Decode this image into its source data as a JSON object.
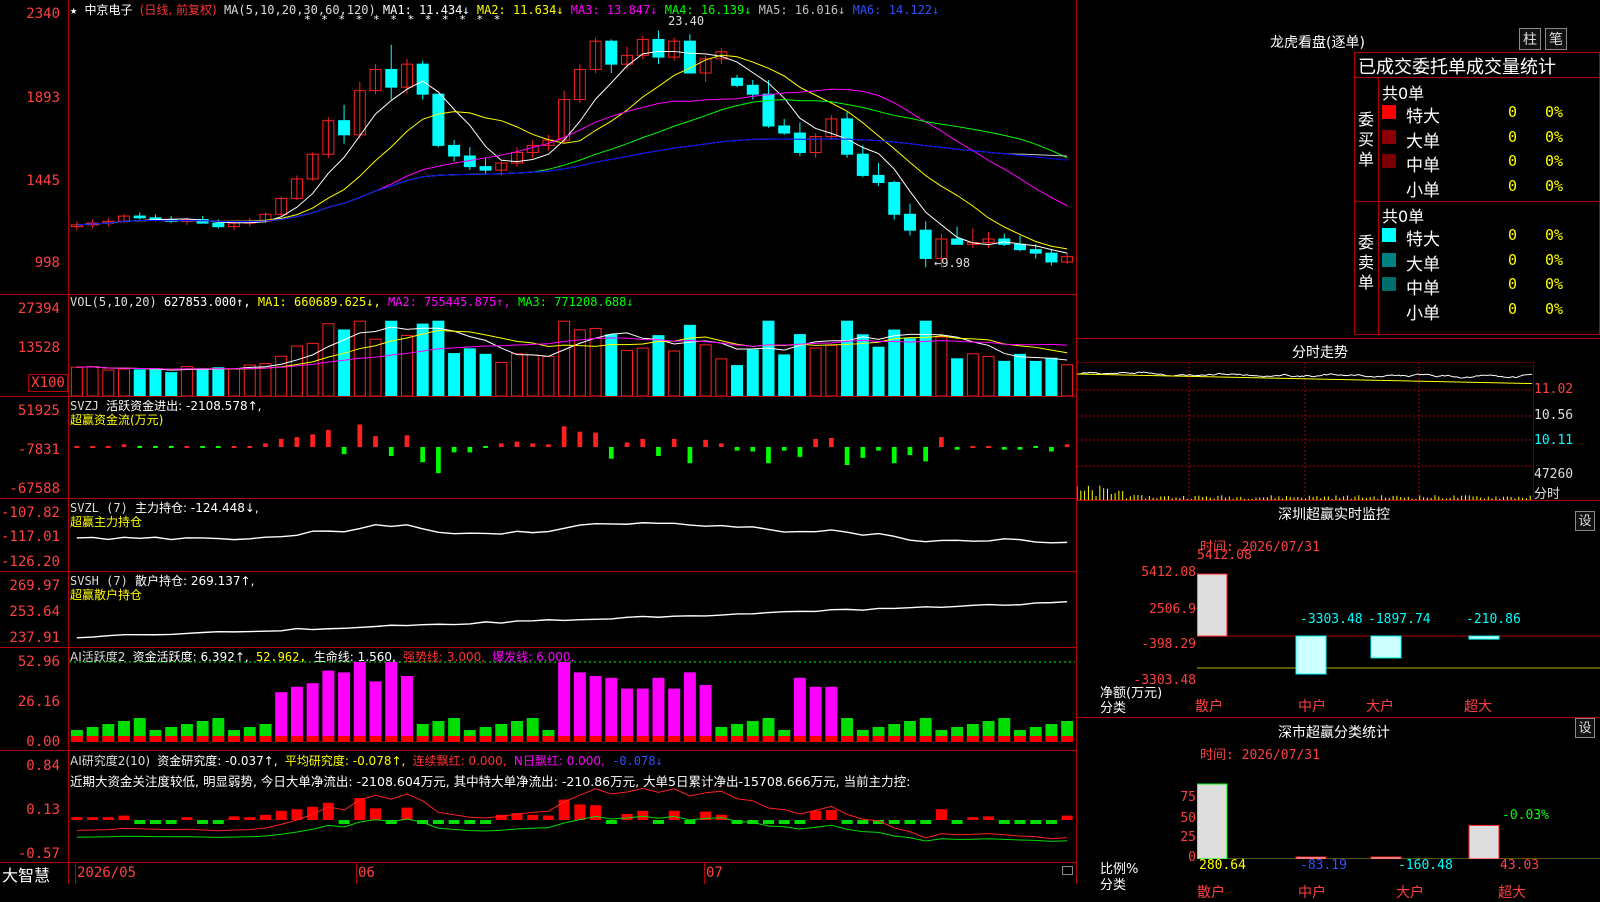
{
  "main_chart": {
    "legend": {
      "star": "★",
      "stock_name": "中京电子",
      "period": "(日线, 前复权)",
      "ma_label": "MA(5,10,20,30,60,120)",
      "ma1": "MA1: 11.434↓",
      "ma2": "MA2: 11.634↓",
      "ma3": "MA3: 13.847↓",
      "ma4": "MA4: 16.139↓",
      "ma5": "MA5: 16.016↓",
      "ma6": "MA6: 14.122↓"
    },
    "yticks": [
      "2340",
      "1893",
      "1445",
      "998"
    ],
    "high_label": "23.40",
    "low_label": "←9.98",
    "stars": "* * * * *  *     *     * * *    * *"
  },
  "vol_panel": {
    "legend": {
      "title": "VOL(5,10,20)",
      "value": "627853.000↑,",
      "ma1": "MA1: 660689.625↓,",
      "ma2": "MA2: 755445.875↑,",
      "ma3": "MA3: 771208.688↓"
    },
    "yticks": [
      "27394",
      "13528",
      "X100"
    ]
  },
  "svzj_panel": {
    "legend": {
      "title": "SVZJ",
      "line": "活跃资金进出: -2108.578↑,",
      "sub": "超赢资金流(万元)"
    },
    "yticks": [
      "51925",
      "-7831",
      "-67588"
    ]
  },
  "svzl_panel": {
    "legend": {
      "title": "SVZL (7)",
      "line": "主力持仓: -124.448↓,",
      "sub": "超赢主力持仓"
    },
    "yticks": [
      "-107.82",
      "-117.01",
      "-126.20"
    ]
  },
  "svsh_panel": {
    "legend": {
      "title": "SVSH (7)",
      "line": "散户持仓: 269.137↑,",
      "sub": "超赢散户持仓"
    },
    "yticks": [
      "269.97",
      "253.64",
      "237.91"
    ]
  },
  "ai_active_panel": {
    "legend": {
      "title": "AI活跃度2",
      "a": "资金活跃度: 6.392↑,",
      "b": "52.962,",
      "c": "生命线: 1.560,",
      "d": "强势线: 3.000,",
      "e": "爆发线: 6.000,"
    },
    "yticks": [
      "52.96",
      "26.16",
      "0.00"
    ]
  },
  "ai_research_panel": {
    "legend": {
      "title": "AI研究度2(10)",
      "a": "资金研究度: -0.037↑,",
      "b": "平均研究度: -0.078↑,",
      "c": "连续飘红: 0.000,",
      "d": "N日飘红: 0.000,",
      "e": "-0.078↓"
    },
    "text": "近期大资金关注度较低, 明显弱势, 今日大单净流出: -2108.604万元, 其中特大单净流出: -210.86万元, 大单5日累计净出-15708.666万元, 当前主力控:",
    "yticks": [
      "0.84",
      "0.13",
      "-0.57"
    ]
  },
  "bottom_bar": {
    "brand": "大智慧",
    "dates": [
      "2026/05",
      "06",
      "07"
    ]
  },
  "longhu": {
    "title": "龙虎看盘(逐单)",
    "btn_zhu": "柱",
    "btn_bi": "笔",
    "header": "已成交委托单成交量统计",
    "buy": {
      "side_label": "委买单",
      "total": "共0单",
      "rows": [
        {
          "name": "特大",
          "count": "0",
          "pct": "0%",
          "color": "#ff0000"
        },
        {
          "name": "大单",
          "count": "0",
          "pct": "0%",
          "color": "#8b0000"
        },
        {
          "name": "中单",
          "count": "0",
          "pct": "0%",
          "color": "#7a0000"
        },
        {
          "name": "小单",
          "count": "0",
          "pct": "0%",
          "color": "#000000"
        }
      ]
    },
    "sell": {
      "side_label": "委卖单",
      "total": "共0单",
      "rows": [
        {
          "name": "特大",
          "count": "0",
          "pct": "0%",
          "color": "#00ffff"
        },
        {
          "name": "大单",
          "count": "0",
          "pct": "0%",
          "color": "#008080"
        },
        {
          "name": "中单",
          "count": "0",
          "pct": "0%",
          "color": "#006d6d"
        },
        {
          "name": "小单",
          "count": "0",
          "pct": "0%",
          "color": "#000000"
        }
      ]
    }
  },
  "intraday": {
    "title": "分时走势",
    "yticks": [
      "11.02",
      "10.56",
      "10.11",
      "47260"
    ],
    "fen": "分时"
  },
  "monitor": {
    "title": "深圳超赢实时监控",
    "set": "设",
    "time": "时间: 2026/07/31",
    "yticks": [
      "5412.08",
      "2506.9",
      "-398.29",
      "-3303.48"
    ],
    "ylabel": "净额(万元)",
    "xlabel": "分类",
    "cats": [
      "散户",
      "中户",
      "大户",
      "超大"
    ],
    "values": [
      "5412.08",
      "-3303.48",
      "-1897.74",
      "-210.86"
    ]
  },
  "classify": {
    "title": "深市超赢分类统计",
    "set": "设",
    "time": "时间: 2026/07/31",
    "yticks": [
      "75",
      "50",
      "25",
      "0"
    ],
    "ylabel": "比例%",
    "xlabel": "分类",
    "cats": [
      "散户",
      "中户",
      "大户",
      "超大"
    ],
    "values": [
      "280.64",
      "-83.19",
      "-160.48",
      "43.03"
    ],
    "top_label": "-0.03%"
  },
  "chart_data": [
    {
      "type": "candlestick",
      "title": "中京电子 (日线, 前复权)",
      "ylim": [
        9.98,
        23.4
      ],
      "series": [
        {
          "name": "MA1",
          "color": "#ffffff"
        },
        {
          "name": "MA2",
          "color": "#ffff00"
        },
        {
          "name": "MA3",
          "color": "#ff00ff"
        },
        {
          "name": "MA4",
          "color": "#00ff00"
        },
        {
          "name": "MA5",
          "color": "#c0c0c0"
        },
        {
          "name": "MA6",
          "color": "#0000ff"
        }
      ],
      "ohlc": [
        [
          12.3,
          12.6,
          12.1,
          12.4
        ],
        [
          12.4,
          12.7,
          12.2,
          12.5
        ],
        [
          12.5,
          12.8,
          12.3,
          12.6
        ],
        [
          12.6,
          13.0,
          12.5,
          12.9
        ],
        [
          12.9,
          13.1,
          12.7,
          12.8
        ],
        [
          12.8,
          13.0,
          12.6,
          12.7
        ],
        [
          12.7,
          12.9,
          12.5,
          12.6
        ],
        [
          12.6,
          12.8,
          12.4,
          12.7
        ],
        [
          12.7,
          12.9,
          12.5,
          12.5
        ],
        [
          12.5,
          12.7,
          12.2,
          12.3
        ],
        [
          12.3,
          12.6,
          12.1,
          12.5
        ],
        [
          12.5,
          12.8,
          12.3,
          12.6
        ],
        [
          12.6,
          13.1,
          12.5,
          13.0
        ],
        [
          13.0,
          14.0,
          12.9,
          13.9
        ],
        [
          13.9,
          15.2,
          13.8,
          15.0
        ],
        [
          15.0,
          16.5,
          14.9,
          16.4
        ],
        [
          16.4,
          18.5,
          16.2,
          18.3
        ],
        [
          18.3,
          19.2,
          17.0,
          17.5
        ],
        [
          17.5,
          20.5,
          17.3,
          20.0
        ],
        [
          20.0,
          21.5,
          19.8,
          21.2
        ],
        [
          21.2,
          22.6,
          19.5,
          20.2
        ],
        [
          20.2,
          21.8,
          19.8,
          21.5
        ],
        [
          21.5,
          21.7,
          19.5,
          19.8
        ],
        [
          19.8,
          19.8,
          16.8,
          16.9
        ],
        [
          16.9,
          17.2,
          16.0,
          16.3
        ],
        [
          16.3,
          16.8,
          15.5,
          15.7
        ],
        [
          15.7,
          16.2,
          15.3,
          15.5
        ],
        [
          15.5,
          16.0,
          15.2,
          15.9
        ],
        [
          15.9,
          16.8,
          15.7,
          16.5
        ],
        [
          16.5,
          17.2,
          16.2,
          16.9
        ],
        [
          16.9,
          17.5,
          16.6,
          17.2
        ],
        [
          17.2,
          20.0,
          17.0,
          19.5
        ],
        [
          19.5,
          21.5,
          19.3,
          21.2
        ],
        [
          21.2,
          23.0,
          21.0,
          22.8
        ],
        [
          22.8,
          22.9,
          21.0,
          21.5
        ],
        [
          21.5,
          22.5,
          21.2,
          22.0
        ],
        [
          22.0,
          23.1,
          21.8,
          22.9
        ],
        [
          22.9,
          23.4,
          21.5,
          21.9
        ],
        [
          21.9,
          23.0,
          21.7,
          22.8
        ],
        [
          22.8,
          23.2,
          21.0,
          21.0
        ],
        [
          21.0,
          22.0,
          20.5,
          21.8
        ],
        [
          21.8,
          22.4,
          21.5,
          22.2
        ],
        [
          20.7,
          20.9,
          20.2,
          20.3
        ],
        [
          20.3,
          20.6,
          19.5,
          19.8
        ],
        [
          19.8,
          20.6,
          17.9,
          18.0
        ],
        [
          18.0,
          18.4,
          17.5,
          17.6
        ],
        [
          17.6,
          18.2,
          16.3,
          16.5
        ],
        [
          16.5,
          17.6,
          16.2,
          17.4
        ],
        [
          17.4,
          18.6,
          17.2,
          18.4
        ],
        [
          18.4,
          18.8,
          16.2,
          16.4
        ],
        [
          16.4,
          16.9,
          15.1,
          15.2
        ],
        [
          15.2,
          15.9,
          14.6,
          14.8
        ],
        [
          14.8,
          14.9,
          12.7,
          13.0
        ],
        [
          13.0,
          13.6,
          11.8,
          12.1
        ],
        [
          12.1,
          12.6,
          10.0,
          10.5
        ],
        [
          10.5,
          11.9,
          9.98,
          11.6
        ],
        [
          11.6,
          12.3,
          11.3,
          11.3
        ],
        [
          11.3,
          12.2,
          11.1,
          11.4
        ],
        [
          11.4,
          12.0,
          11.1,
          11.6
        ],
        [
          11.6,
          11.9,
          11.2,
          11.3
        ],
        [
          11.3,
          11.8,
          10.9,
          11.0
        ],
        [
          11.0,
          11.3,
          10.5,
          10.8
        ],
        [
          10.8,
          11.0,
          10.1,
          10.3
        ],
        [
          10.3,
          10.8,
          10.2,
          10.6
        ]
      ]
    }
  ]
}
